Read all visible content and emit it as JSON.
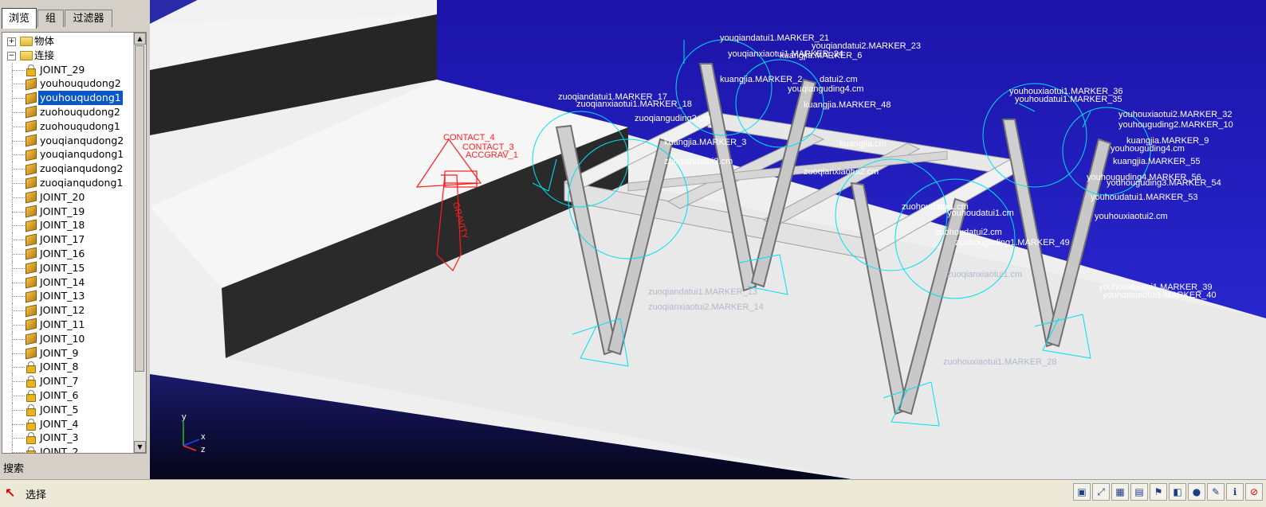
{
  "tabs": [
    {
      "label": "浏览",
      "active": true
    },
    {
      "label": "组",
      "active": false
    },
    {
      "label": "过滤器",
      "active": false
    }
  ],
  "tree": {
    "folders": [
      {
        "label": "物体",
        "expander": "+"
      },
      {
        "label": "连接",
        "expander": "−"
      }
    ],
    "items": [
      {
        "label": "JOINT_29",
        "icon": "lock-icon"
      },
      {
        "label": "youhouqudong2",
        "icon": "motion-icon"
      },
      {
        "label": "youhouqudong1",
        "icon": "motion-icon",
        "selected": true
      },
      {
        "label": "zuohouqudong2",
        "icon": "motion-icon"
      },
      {
        "label": "zuohouqudong1",
        "icon": "motion-icon"
      },
      {
        "label": "youqianqudong2",
        "icon": "motion-icon"
      },
      {
        "label": "youqianqudong1",
        "icon": "motion-icon"
      },
      {
        "label": "zuoqianqudong2",
        "icon": "motion-icon"
      },
      {
        "label": "zuoqianqudong1",
        "icon": "motion-icon"
      },
      {
        "label": "JOINT_20",
        "icon": "motion-icon"
      },
      {
        "label": "JOINT_19",
        "icon": "motion-icon"
      },
      {
        "label": "JOINT_18",
        "icon": "motion-icon"
      },
      {
        "label": "JOINT_17",
        "icon": "motion-icon"
      },
      {
        "label": "JOINT_16",
        "icon": "motion-icon"
      },
      {
        "label": "JOINT_15",
        "icon": "motion-icon"
      },
      {
        "label": "JOINT_14",
        "icon": "motion-icon"
      },
      {
        "label": "JOINT_13",
        "icon": "motion-icon"
      },
      {
        "label": "JOINT_12",
        "icon": "motion-icon"
      },
      {
        "label": "JOINT_11",
        "icon": "motion-icon"
      },
      {
        "label": "JOINT_10",
        "icon": "motion-icon"
      },
      {
        "label": "JOINT_9",
        "icon": "motion-icon"
      },
      {
        "label": "JOINT_8",
        "icon": "lock-icon"
      },
      {
        "label": "JOINT_7",
        "icon": "lock-icon"
      },
      {
        "label": "JOINT_6",
        "icon": "lock-icon"
      },
      {
        "label": "JOINT_5",
        "icon": "lock-icon"
      },
      {
        "label": "JOINT_4",
        "icon": "lock-icon"
      },
      {
        "label": "JOINT_3",
        "icon": "lock-icon"
      },
      {
        "label": "JOINT_2",
        "icon": "lock-icon"
      }
    ]
  },
  "search_label": "搜索",
  "status": {
    "text": "选择",
    "icon": "select-arrow-icon"
  },
  "viewport": {
    "axis": {
      "x": "x",
      "y": "y",
      "z": "z"
    },
    "red_labels": [
      "CONTACT_4",
      "CONTACT_3",
      "ACCGRAV_1",
      "GRAVITY"
    ],
    "labels": [
      "youqiandatui1.MARKER_21",
      "youqiandatui2.MARKER_23",
      "youqianxiaotui1.MARKER_24",
      "kuangjia.MARKER_6",
      "datui2.cm",
      "youqianguding4.cm",
      "kuangjia.MARKER_2",
      "zuoqiandatui1.MARKER_17",
      "zuoqianxiaotui1.MARKER_18",
      "kuangjia.MARKER_48",
      "zuoqianguding2.cm",
      "youhouxiaotui1.MARKER_36",
      "youhoudatui1.MARKER_35",
      "youhouxiaotui2.MARKER_32",
      "youhouguding2.MARKER_10",
      "kuangjia.MARKER_3",
      "kuangjia.cm",
      "youhouguding4.cm",
      "kuangjia.MARKER_9",
      "kuangjia.MARKER_55",
      "zuoqiandatui2.cm",
      "zuoqianxiaotui2.cm",
      "youhouguding4.MARKER_56",
      "youhouguding3.MARKER_54",
      "youhoudatui1.MARKER_53",
      "zuohoudatui1.cm",
      "youhoudatui1.cm",
      "youhouxiaotui2.cm",
      "zuohoudatui2.cm",
      "zuohouguding1.MARKER_49",
      "youhouxiaotui1.MARKER_39",
      "youhouxiaotui1.MARKER_40",
      "zuoqiandatui1.MARKER_13",
      "zuoqianxiaotui2.MARKER_14",
      "zuohouxiaotui1.MARKER_28",
      "zuoqianxiaotui1.cm"
    ]
  }
}
